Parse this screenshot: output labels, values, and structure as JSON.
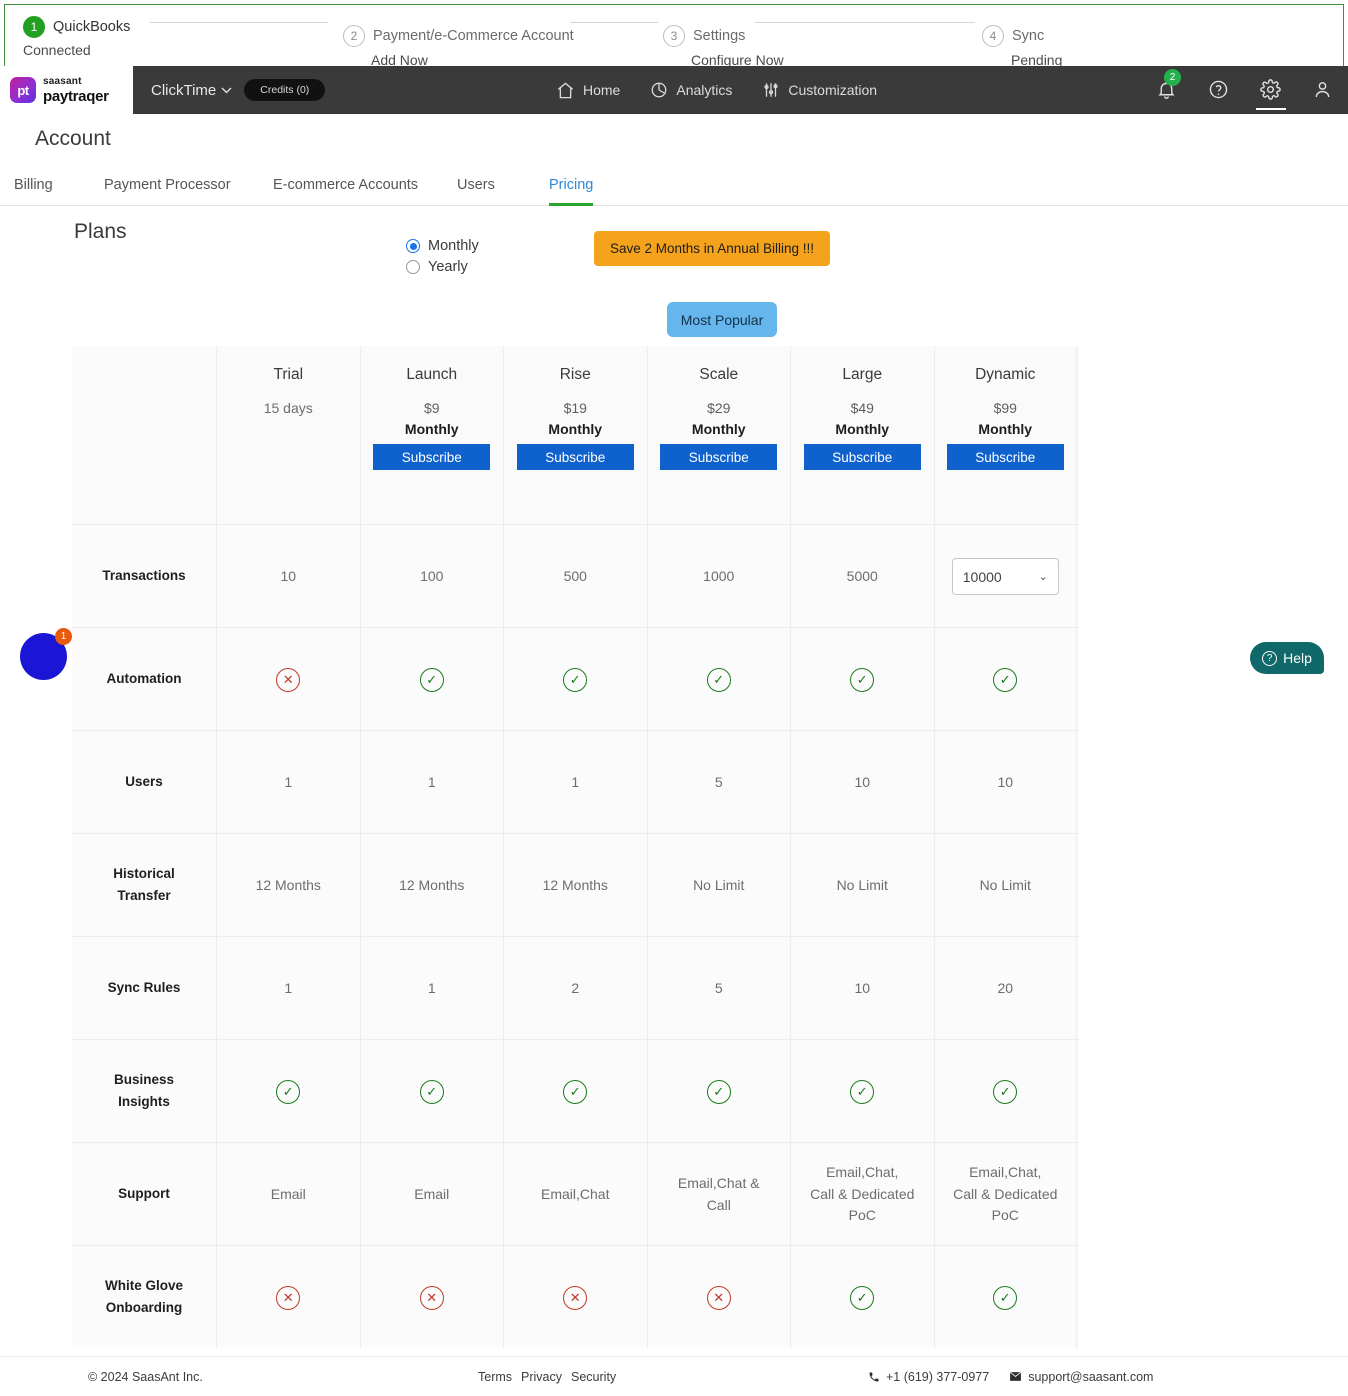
{
  "stepper": {
    "steps": [
      {
        "num": "1",
        "title": "QuickBooks",
        "sub": "Connected",
        "state": "done"
      },
      {
        "num": "2",
        "title": "Payment/e-Commerce Account",
        "sub": "Add Now",
        "state": "todo"
      },
      {
        "num": "3",
        "title": "Settings",
        "sub": "Configure Now",
        "state": "todo"
      },
      {
        "num": "4",
        "title": "Sync",
        "sub": "Pending",
        "state": "todo"
      }
    ]
  },
  "topnav": {
    "logo_top": "saasant",
    "logo_bottom": "paytraqer",
    "logo_mark": "pt",
    "account_selector": "ClickTime",
    "credits": "Credits (0)",
    "items": [
      {
        "label": "Home",
        "icon": "home-icon"
      },
      {
        "label": "Analytics",
        "icon": "pie-chart-icon"
      },
      {
        "label": "Customization",
        "icon": "sliders-icon"
      }
    ],
    "notification_count": "2"
  },
  "page": {
    "title": "Account",
    "tabs": [
      {
        "label": "Billing",
        "active": false
      },
      {
        "label": "Payment Processor",
        "active": false
      },
      {
        "label": "E-commerce Accounts",
        "active": false
      },
      {
        "label": "Users",
        "active": false
      },
      {
        "label": "Pricing",
        "active": true
      }
    ]
  },
  "plans": {
    "heading": "Plans",
    "billing_options": [
      {
        "label": "Monthly",
        "selected": true
      },
      {
        "label": "Yearly",
        "selected": false
      }
    ],
    "save_banner": "Save 2 Months in Annual Billing !!!",
    "most_popular": "Most Popular"
  },
  "pricing_table": {
    "columns": [
      {
        "name": "Trial",
        "price": "",
        "period": "",
        "sub": "15 days",
        "cta": ""
      },
      {
        "name": "Launch",
        "price": "$9",
        "period": "Monthly",
        "sub": "",
        "cta": "Subscribe"
      },
      {
        "name": "Rise",
        "price": "$19",
        "period": "Monthly",
        "sub": "",
        "cta": "Subscribe"
      },
      {
        "name": "Scale",
        "price": "$29",
        "period": "Monthly",
        "sub": "",
        "cta": "Subscribe"
      },
      {
        "name": "Large",
        "price": "$49",
        "period": "Monthly",
        "sub": "",
        "cta": "Subscribe"
      },
      {
        "name": "Dynamic",
        "price": "$99",
        "period": "Monthly",
        "sub": "",
        "cta": "Subscribe"
      }
    ],
    "rows": [
      {
        "label": "Transactions",
        "cells": [
          {
            "type": "text",
            "value": "10"
          },
          {
            "type": "text",
            "value": "100"
          },
          {
            "type": "text",
            "value": "500"
          },
          {
            "type": "text",
            "value": "1000"
          },
          {
            "type": "text",
            "value": "5000"
          },
          {
            "type": "select",
            "value": "10000"
          }
        ]
      },
      {
        "label": "Automation",
        "cells": [
          {
            "type": "icon",
            "value": "no"
          },
          {
            "type": "icon",
            "value": "yes"
          },
          {
            "type": "icon",
            "value": "yes"
          },
          {
            "type": "icon",
            "value": "yes"
          },
          {
            "type": "icon",
            "value": "yes"
          },
          {
            "type": "icon",
            "value": "yes"
          }
        ]
      },
      {
        "label": "Users",
        "cells": [
          {
            "type": "text",
            "value": "1"
          },
          {
            "type": "text",
            "value": "1"
          },
          {
            "type": "text",
            "value": "1"
          },
          {
            "type": "text",
            "value": "5"
          },
          {
            "type": "text",
            "value": "10"
          },
          {
            "type": "text",
            "value": "10"
          }
        ]
      },
      {
        "label": "Historical\nTransfer",
        "cells": [
          {
            "type": "text",
            "value": "12 Months"
          },
          {
            "type": "text",
            "value": "12 Months"
          },
          {
            "type": "text",
            "value": "12 Months"
          },
          {
            "type": "text",
            "value": "No Limit"
          },
          {
            "type": "text",
            "value": "No Limit"
          },
          {
            "type": "text",
            "value": "No Limit"
          }
        ]
      },
      {
        "label": "Sync Rules",
        "cells": [
          {
            "type": "text",
            "value": "1"
          },
          {
            "type": "text",
            "value": "1"
          },
          {
            "type": "text",
            "value": "2"
          },
          {
            "type": "text",
            "value": "5"
          },
          {
            "type": "text",
            "value": "10"
          },
          {
            "type": "text",
            "value": "20"
          }
        ]
      },
      {
        "label": "Business\nInsights",
        "cells": [
          {
            "type": "icon",
            "value": "yes"
          },
          {
            "type": "icon",
            "value": "yes"
          },
          {
            "type": "icon",
            "value": "yes"
          },
          {
            "type": "icon",
            "value": "yes"
          },
          {
            "type": "icon",
            "value": "yes"
          },
          {
            "type": "icon",
            "value": "yes"
          }
        ]
      },
      {
        "label": "Support",
        "cells": [
          {
            "type": "text",
            "value": "Email"
          },
          {
            "type": "text",
            "value": "Email"
          },
          {
            "type": "text",
            "value": "Email,Chat"
          },
          {
            "type": "text",
            "value": "Email,Chat &\nCall"
          },
          {
            "type": "text",
            "value": "Email,Chat,\nCall & Dedicated\nPoC"
          },
          {
            "type": "text",
            "value": "Email,Chat,\nCall & Dedicated\nPoC"
          }
        ]
      },
      {
        "label": "White Glove\nOnboarding",
        "cells": [
          {
            "type": "icon",
            "value": "no"
          },
          {
            "type": "icon",
            "value": "no"
          },
          {
            "type": "icon",
            "value": "no"
          },
          {
            "type": "icon",
            "value": "no"
          },
          {
            "type": "icon",
            "value": "yes"
          },
          {
            "type": "icon",
            "value": "yes"
          }
        ]
      }
    ]
  },
  "widgets": {
    "chat_badge": "1",
    "help_label": "Help"
  },
  "footer": {
    "copyright": "© 2024 SaasAnt Inc.",
    "links": [
      "Terms",
      "Privacy",
      "Security"
    ],
    "phone": "+1 (619) 377-0977",
    "email": "support@saasant.com"
  },
  "colors": {
    "accent_green": "#22a022",
    "tab_active": "#2e87d6",
    "subscribe_blue": "#0f62cd",
    "banner_orange": "#f5a21c",
    "popular_blue": "#64b6ec",
    "help_teal": "#10686b",
    "check_green": "#1a7a1a",
    "cross_red": "#c0392b"
  }
}
